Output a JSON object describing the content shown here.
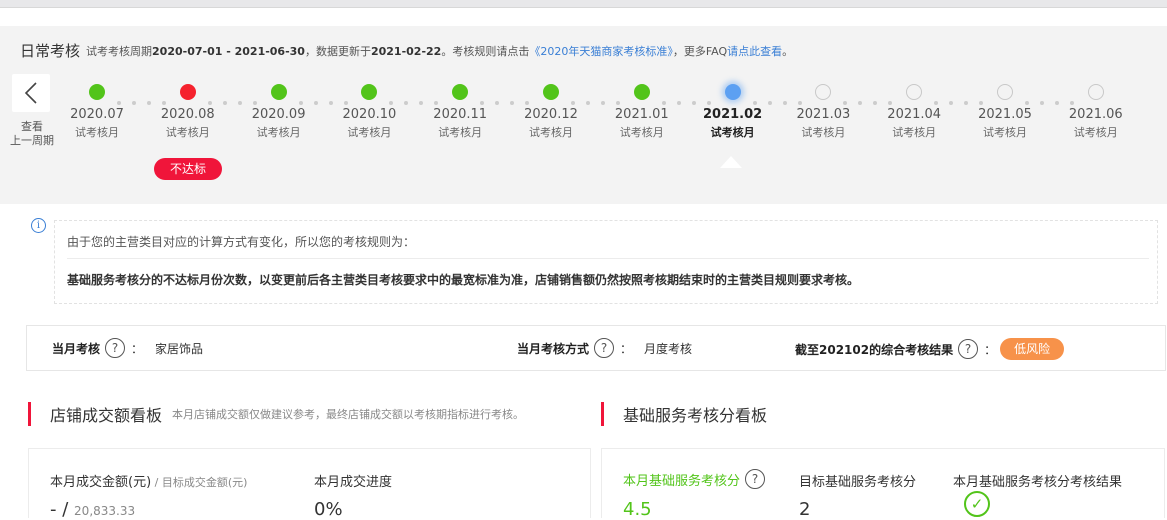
{
  "header": {
    "title": "日常考核",
    "desc_prefix": "试考考核周期",
    "period": "2020-07-01 - 2021-06-30",
    "update_prefix": "，数据更新于",
    "update_date": "2021-02-22",
    "rules_prefix": "。考核规则请点击",
    "rules_link": "《2020年天猫商家考核标准》",
    "faq_prefix": "，更多FAQ",
    "faq_link": "请点此查看",
    "faq_suffix": "。"
  },
  "prev": {
    "label_line1": "查看",
    "label_line2": "上一周期"
  },
  "timeline": [
    {
      "month": "2020.07",
      "sub": "试考核月",
      "status": "green"
    },
    {
      "month": "2020.08",
      "sub": "试考核月",
      "status": "red",
      "badge": "不达标"
    },
    {
      "month": "2020.09",
      "sub": "试考核月",
      "status": "green"
    },
    {
      "month": "2020.10",
      "sub": "试考核月",
      "status": "green"
    },
    {
      "month": "2020.11",
      "sub": "试考核月",
      "status": "green"
    },
    {
      "month": "2020.12",
      "sub": "试考核月",
      "status": "green"
    },
    {
      "month": "2021.01",
      "sub": "试考核月",
      "status": "green"
    },
    {
      "month": "2021.02",
      "sub": "试考核月",
      "status": "current"
    },
    {
      "month": "2021.03",
      "sub": "试考核月",
      "status": "empty"
    },
    {
      "month": "2021.04",
      "sub": "试考核月",
      "status": "empty"
    },
    {
      "month": "2021.05",
      "sub": "试考核月",
      "status": "empty"
    },
    {
      "month": "2021.06",
      "sub": "试考核月",
      "status": "empty"
    }
  ],
  "notice": {
    "line1": "由于您的主营类目对应的计算方式有变化，所以您的考核规则为：",
    "line2": "基础服务考核分的不达标月份次数，以变更前后各主营类目考核要求中的最宽标准为准，店铺销售额仍然按照考核期结束时的主营类目规则要求考核。"
  },
  "summary": {
    "monthly_label": "当月考核",
    "monthly_value": "家居饰品",
    "method_label": "当月考核方式",
    "method_value": "月度考核",
    "result_label": "截至202102的综合考核结果",
    "result_value": "低风险",
    "colon": "："
  },
  "sales_board": {
    "title": "店铺成交额看板",
    "note": "本月店铺成交额仅做建议参考，最终店铺成交额以考核期指标进行考核。",
    "amount_label": "本月成交金额(元)",
    "target_label": " / 目标成交金额(元)",
    "amount_value": "-",
    "target_value": "20,833.33",
    "progress_label": "本月成交进度",
    "progress_value": "0%"
  },
  "service_board": {
    "title": "基础服务考核分看板",
    "score_label": "本月基础服务考核分",
    "score_value": "4.5",
    "target_label": "目标基础服务考核分",
    "target_value": "2",
    "result_label": "本月基础服务考核分考核结果"
  },
  "colors": {
    "green": "#52c41a",
    "red": "#f5222d",
    "accent_red": "#f0153a",
    "risk_orange": "#f7924a",
    "link_blue": "#3a7fd5"
  }
}
